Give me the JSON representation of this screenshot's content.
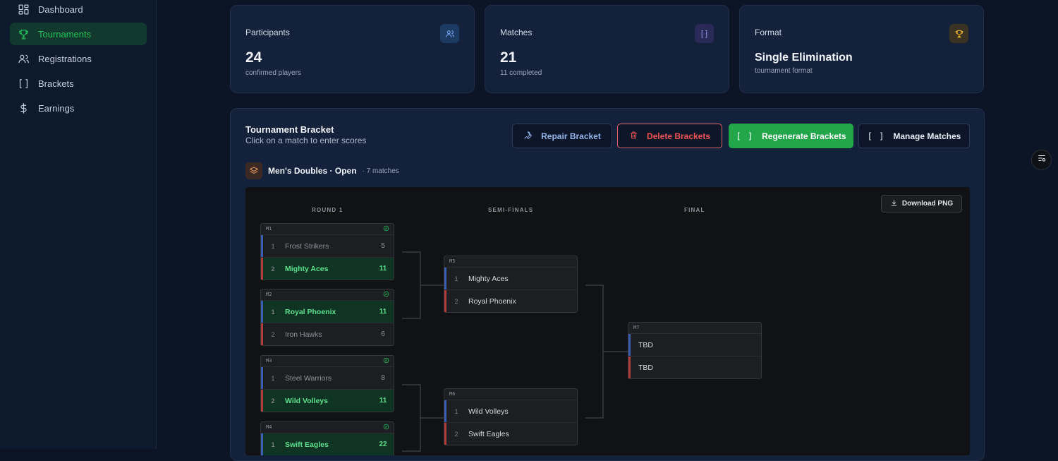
{
  "sidebar": {
    "items": [
      {
        "label": "Dashboard",
        "icon": "dashboard-icon"
      },
      {
        "label": "Tournaments",
        "icon": "trophy-icon",
        "active": true
      },
      {
        "label": "Registrations",
        "icon": "users-icon"
      },
      {
        "label": "Brackets",
        "icon": "brackets-icon"
      },
      {
        "label": "Earnings",
        "icon": "dollar-icon"
      }
    ]
  },
  "stats": {
    "participants": {
      "label": "Participants",
      "value": "24",
      "sub": "confirmed players",
      "icon": "users-icon"
    },
    "matches": {
      "label": "Matches",
      "value": "21",
      "sub": "11 completed",
      "icon": "brackets-icon",
      "icon_text": "[ ]"
    },
    "format": {
      "label": "Format",
      "value": "Single Elimination",
      "sub": "tournament format",
      "icon": "trophy-icon"
    }
  },
  "bracket": {
    "title": "Tournament Bracket",
    "subtitle": "Click on a match to enter scores",
    "buttons": {
      "repair": "Repair Bracket",
      "delete": "Delete Brackets",
      "regenerate": "Regenerate Brackets",
      "manage": "Manage Matches",
      "bracket_glyph": "[ ]"
    },
    "division": {
      "name": "Men's Doubles · Open",
      "count": "· 7 matches"
    },
    "download": "Download PNG",
    "rounds": [
      "ROUND 1",
      "SEMI-FINALS",
      "FINAL"
    ],
    "matches": {
      "m1": {
        "id": "M1",
        "a": {
          "seed": "1",
          "name": "Frost Strikers",
          "score": "5"
        },
        "b": {
          "seed": "2",
          "name": "Mighty Aces",
          "score": "11"
        }
      },
      "m2": {
        "id": "M2",
        "a": {
          "seed": "1",
          "name": "Royal Phoenix",
          "score": "11"
        },
        "b": {
          "seed": "2",
          "name": "Iron Hawks",
          "score": "6"
        }
      },
      "m3": {
        "id": "M3",
        "a": {
          "seed": "1",
          "name": "Steel Warriors",
          "score": "8"
        },
        "b": {
          "seed": "2",
          "name": "Wild Volleys",
          "score": "11"
        }
      },
      "m4": {
        "id": "M4",
        "a": {
          "seed": "1",
          "name": "Swift Eagles",
          "score": "22"
        }
      },
      "m5": {
        "id": "M5",
        "a": {
          "seed": "1",
          "name": "Mighty Aces"
        },
        "b": {
          "seed": "2",
          "name": "Royal Phoenix"
        }
      },
      "m6": {
        "id": "M6",
        "a": {
          "seed": "1",
          "name": "Wild Volleys"
        },
        "b": {
          "seed": "2",
          "name": "Swift Eagles"
        }
      },
      "m7": {
        "id": "M7",
        "a": {
          "name": "TBD"
        },
        "b": {
          "name": "TBD"
        }
      }
    }
  },
  "colors": {
    "accent_green": "#22c55e",
    "background": "#0b1526",
    "card": "#14213a",
    "danger": "#ef5555"
  }
}
